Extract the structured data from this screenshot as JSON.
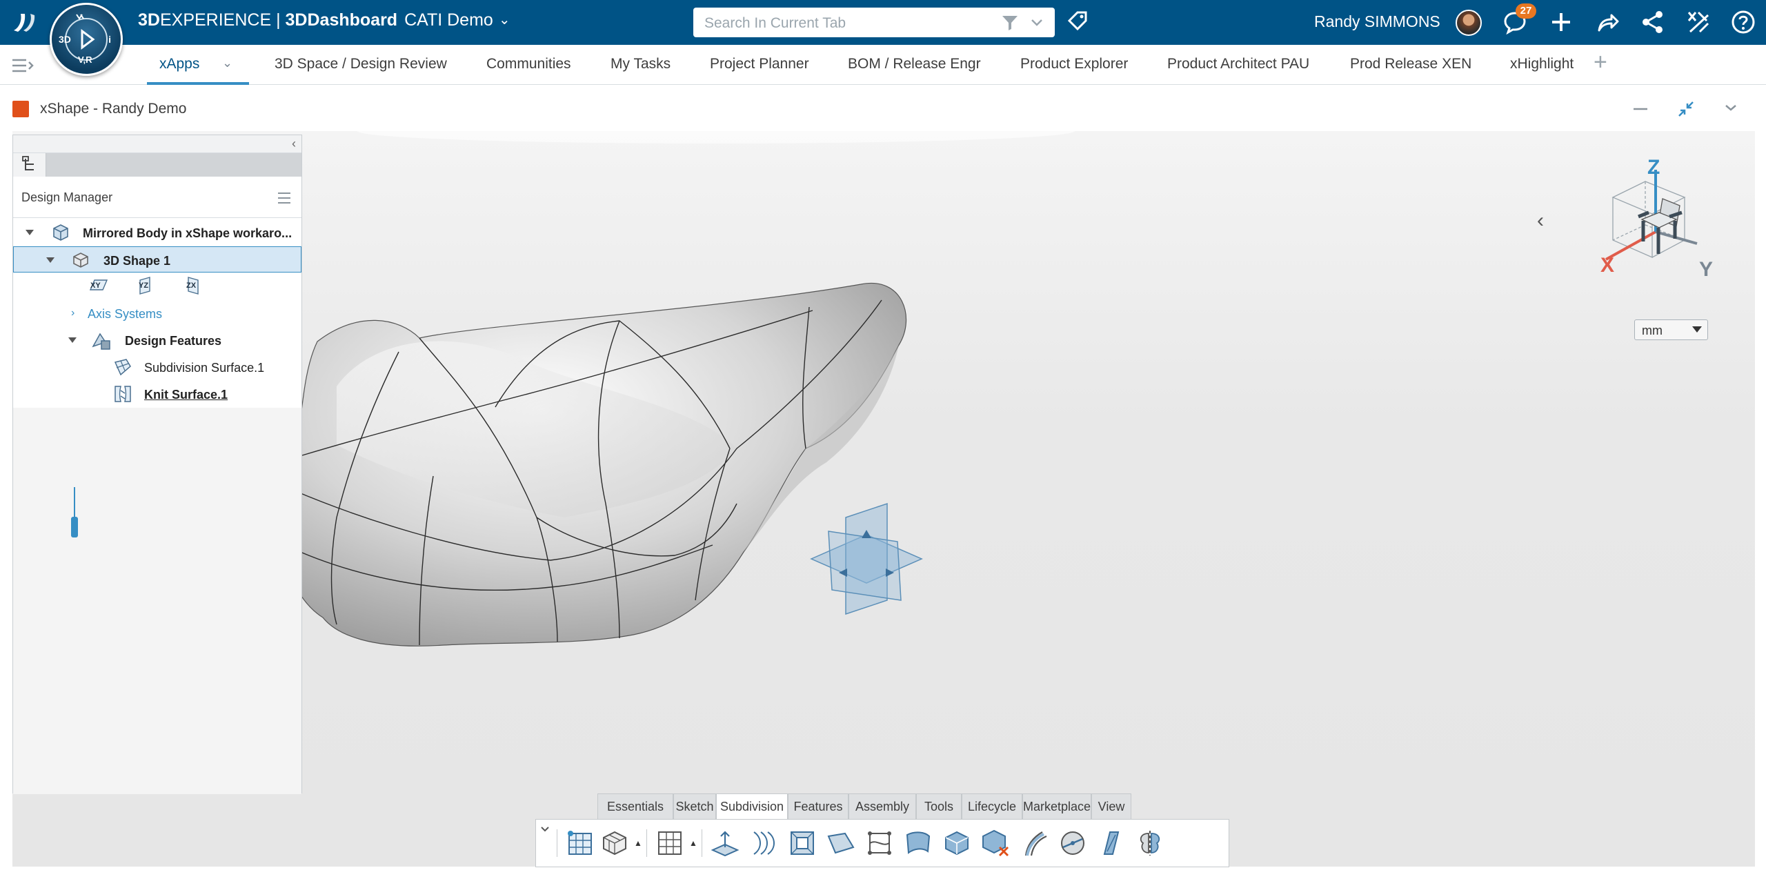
{
  "topbar": {
    "brand_prefix": "3D",
    "brand_mid": "EXPERIENCE",
    "brand_sep": " | ",
    "brand_app": "3DDashboard",
    "tenant": "CATI Demo",
    "compass_labels": {
      "top": "V,R",
      "bottom": "V,R",
      "left": "3D",
      "right": "i"
    },
    "search_placeholder": "Search In Current Tab",
    "user_name": "Randy SIMMONS",
    "notification_count": "27"
  },
  "tabs": [
    {
      "label": "xApps",
      "active": true
    },
    {
      "label": "3D Space / Design Review"
    },
    {
      "label": "Communities"
    },
    {
      "label": "My Tasks"
    },
    {
      "label": "Project Planner"
    },
    {
      "label": "BOM / Release Engr"
    },
    {
      "label": "Product Explorer"
    },
    {
      "label": "Product Architect PAU"
    },
    {
      "label": "Prod Release XEN"
    },
    {
      "label": "xHighlight"
    }
  ],
  "widget": {
    "title": "xShape - Randy Demo"
  },
  "tree": {
    "title": "Design Manager",
    "root": "Mirrored Body in xShape workaro...",
    "shape": "3D Shape 1",
    "planes": [
      "XY",
      "YZ",
      "ZX"
    ],
    "axis_systems": "Axis Systems",
    "design_features": "Design Features",
    "features": [
      "Subdivision Surface.1",
      "Knit Surface.1"
    ]
  },
  "compass_cube": {
    "x": "X",
    "y": "Y",
    "z": "Z"
  },
  "unit_select": "mm",
  "action_bar": {
    "tabs": [
      "Essentials",
      "Sketch",
      "Subdivision",
      "Features",
      "Assembly",
      "Tools",
      "Lifecycle",
      "Marketplace",
      "View"
    ],
    "active_tab": "Subdivision",
    "icons": [
      "subdivision-grid-icon",
      "primitive-cube-icon",
      "grid-plane-icon",
      "extrude-icon",
      "curve-surface-icon",
      "face-inset-icon",
      "face-split-icon",
      "edge-cut-icon",
      "sweep-surface-icon",
      "box-surface-icon",
      "delete-face-icon",
      "bend-curve-icon",
      "sphere-icon",
      "ruler-blade-icon",
      "symmetric-part-icon"
    ]
  },
  "colors": {
    "topbar": "#005386",
    "accent": "#368ec4",
    "badge": "#e87722"
  }
}
